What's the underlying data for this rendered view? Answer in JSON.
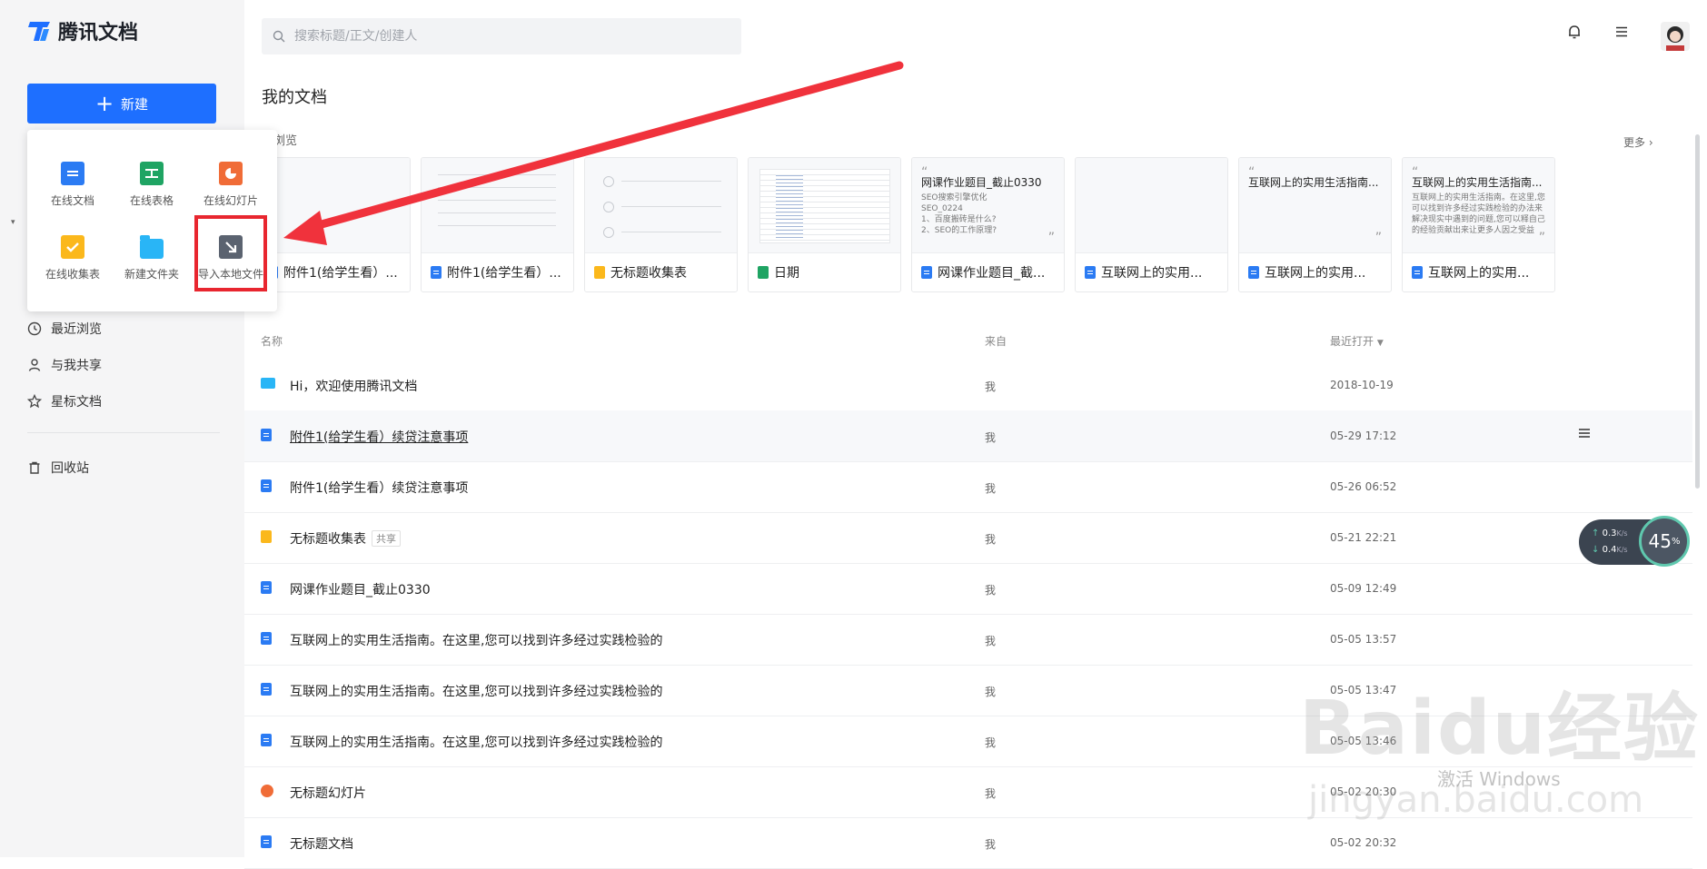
{
  "app": {
    "name": "腾讯文档"
  },
  "sidebar": {
    "new_button": "新建",
    "nav": [
      {
        "label": "最近浏览",
        "icon": "clock-icon"
      },
      {
        "label": "与我共享",
        "icon": "person-icon"
      },
      {
        "label": "星标文档",
        "icon": "star-icon"
      },
      {
        "label": "回收站",
        "icon": "trash-icon"
      }
    ]
  },
  "new_menu": {
    "items": [
      {
        "label": "在线文档",
        "icon": "doc-icon"
      },
      {
        "label": "在线表格",
        "icon": "sheet-icon"
      },
      {
        "label": "在线幻灯片",
        "icon": "slides-icon"
      },
      {
        "label": "在线收集表",
        "icon": "form-icon"
      },
      {
        "label": "新建文件夹",
        "icon": "folder-icon"
      },
      {
        "label": "导入本地文件",
        "icon": "import-icon"
      }
    ]
  },
  "header": {
    "search_placeholder": "搜索标题/正文/创建人"
  },
  "main": {
    "title": "我的文档",
    "recent_label": "近浏览",
    "more_label": "更多",
    "recent_cards": [
      {
        "title": "附件1(给学生看）...",
        "type": "doc"
      },
      {
        "title": "附件1(给学生看）...",
        "type": "doc"
      },
      {
        "title": "无标题收集表",
        "type": "form"
      },
      {
        "title": "日期",
        "type": "sheet"
      },
      {
        "title": "网课作业题目_截...",
        "type": "doc",
        "preview_title": "网课作业题目_截止0330",
        "preview_body": "SEO搜索引擎优化\nSEO_0224\n1、百度搬砖是什么?\n2、SEO的工作原理?"
      },
      {
        "title": "互联网上的实用...",
        "type": "doc"
      },
      {
        "title": "互联网上的实用...",
        "type": "doc",
        "preview_title": "互联网上的实用生活指南..."
      },
      {
        "title": "互联网上的实用...",
        "type": "doc",
        "preview_title": "互联网上的实用生活指南...",
        "preview_body": "互联网上的实用生活指南。在这里,您可以找到许多经过实践检验的办法来解决现实中遇到的问题,您可以释自己的经验贡献出来让更多人因之受益"
      }
    ],
    "table": {
      "headers": {
        "name": "名称",
        "from": "来自",
        "time": "最近打开"
      },
      "rows": [
        {
          "name": "Hi，欢迎使用腾讯文档",
          "type": "folder",
          "from": "我",
          "time": "2018-10-19"
        },
        {
          "name": "附件1(给学生看）续贷注意事项",
          "type": "doc",
          "from": "我",
          "time": "05-29 17:12"
        },
        {
          "name": "附件1(给学生看）续贷注意事项",
          "type": "doc",
          "from": "我",
          "time": "05-26 06:52"
        },
        {
          "name": "无标题收集表",
          "type": "form",
          "from": "我",
          "time": "05-21 22:21",
          "badge": "共享"
        },
        {
          "name": "网课作业题目_截止0330",
          "type": "doc",
          "from": "我",
          "time": "05-09 12:49"
        },
        {
          "name": "互联网上的实用生活指南。在这里,您可以找到许多经过实践检验的",
          "type": "doc",
          "from": "我",
          "time": "05-05 13:57"
        },
        {
          "name": "互联网上的实用生活指南。在这里,您可以找到许多经过实践检验的",
          "type": "doc",
          "from": "我",
          "time": "05-05 13:47"
        },
        {
          "name": "互联网上的实用生活指南。在这里,您可以找到许多经过实践检验的",
          "type": "doc",
          "from": "我",
          "time": "05-05 13:46"
        },
        {
          "name": "无标题幻灯片",
          "type": "slide",
          "from": "我",
          "time": "05-02 20:30"
        },
        {
          "name": "无标题文档",
          "type": "doc",
          "from": "我",
          "time": "05-02 20:32"
        }
      ]
    }
  },
  "speed_widget": {
    "up": "0.3",
    "up_unit": "K/s",
    "down": "0.4",
    "down_unit": "K/s",
    "percent": "45",
    "percent_unit": "%"
  },
  "watermark": {
    "text": "激活 Windows",
    "logo": "Baidu经验",
    "site": "jingyan.baidu.com"
  },
  "colors": {
    "primary": "#1e6fff",
    "highlight": "#e8262f",
    "arrow": "#f0323c"
  }
}
